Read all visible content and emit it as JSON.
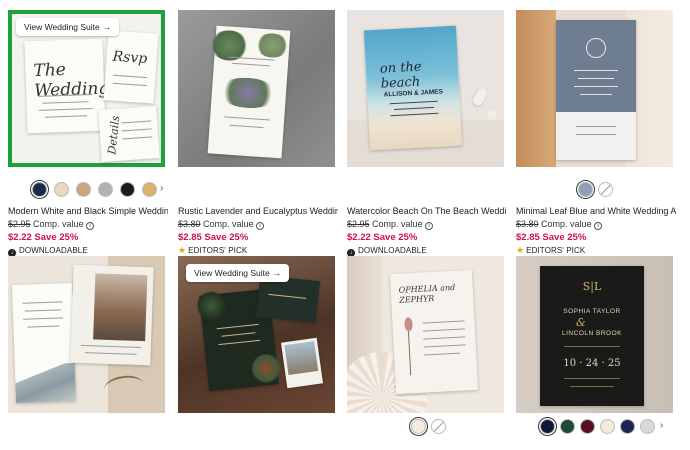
{
  "suite_button_label": "View Wedding Suite",
  "suite_button_arrow": "→",
  "products": [
    {
      "title": "Modern White and Black Simple Wedding...",
      "original_price": "$2.95",
      "comp_label": "Comp. value",
      "sale_price": "$2.22",
      "discount": "Save 25%",
      "badge": "DOWNLOADABLE",
      "badge_icon": "download-icon",
      "swatches": [
        "#1a2a4a",
        "#e8d9bf",
        "#c9a77a",
        "#aeb3b5",
        "#1c1c1c",
        "#d9b36b"
      ],
      "swatch_next": "›"
    },
    {
      "title": "Rustic Lavender and Eucalyptus Weddin...",
      "original_price": "$3.80",
      "comp_label": "Comp. value",
      "sale_price": "$2.85",
      "discount": "Save 25%",
      "badge": "EDITORS' PICK",
      "badge_icon": "star-icon"
    },
    {
      "title": "Watercolor Beach On The Beach Weddin...",
      "original_price": "$2.95",
      "comp_label": "Comp. value",
      "sale_price": "$2.22",
      "discount": "Save 25%",
      "badge": "DOWNLOADABLE",
      "badge_icon": "download-icon"
    },
    {
      "title": "Minimal Leaf Blue and White Wedding All...",
      "original_price": "$3.80",
      "comp_label": "Comp. value",
      "sale_price": "$2.85",
      "discount": "Save 25%",
      "badge": "EDITORS' PICK",
      "badge_icon": "star-icon",
      "swatches": [
        "#8fa0b8"
      ]
    }
  ],
  "row2": [
    {
      "swatches": []
    },
    {
      "swatches": []
    },
    {
      "swatches": [
        "#f4ecdc"
      ]
    },
    {
      "swatches": [
        "#0e1a35",
        "#1f4a34",
        "#5a0f22",
        "#f3ecd8",
        "#1d2550",
        "#d8d8d8"
      ],
      "swatch_next": "›"
    }
  ],
  "card_text": {
    "wedding_script": "The Wedding",
    "rsvp_script": "Rsvp",
    "details_script": "Details",
    "beach_script": "on the beach",
    "beach_names": "ALLISON & JAMES",
    "couple2": "OPHELIA and ZEPHYR",
    "monogram": "S|L",
    "couple3_a": "SOPHIA TAYLOR",
    "couple3_b": "LINCOLN BROOK",
    "date3": "10 · 24 · 25"
  },
  "colors": {
    "selected_outline": "#20a038",
    "sale_price": "#d0134a",
    "editors_star": "#e5a800"
  }
}
